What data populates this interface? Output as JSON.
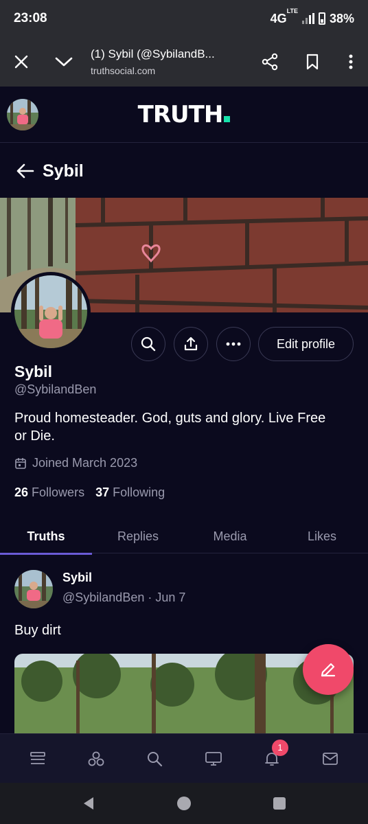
{
  "status_bar": {
    "time": "23:08",
    "network": "4G",
    "network_sub": "LTE",
    "battery": "38%"
  },
  "browser": {
    "page_title": "(1) Sybil (@SybilandB...",
    "domain": "truthsocial.com"
  },
  "header": {
    "logo": "TRUTH"
  },
  "profile_nav": {
    "name": "Sybil"
  },
  "profile": {
    "name": "Sybil",
    "handle": "@SybilandBen",
    "bio": "Proud homesteader. God, guts and glory. Live Free or Die.",
    "joined": "Joined March 2023",
    "followers_count": "26",
    "followers_label": "Followers",
    "following_count": "37",
    "following_label": "Following",
    "edit_label": "Edit profile"
  },
  "tabs": [
    {
      "label": "Truths",
      "active": true
    },
    {
      "label": "Replies",
      "active": false
    },
    {
      "label": "Media",
      "active": false
    },
    {
      "label": "Likes",
      "active": false
    }
  ],
  "post": {
    "author": "Sybil",
    "meta": "@SybilandBen · Jun 7",
    "text": "Buy dirt"
  },
  "bottom_nav": {
    "items": [
      "feed-icon",
      "groups-icon",
      "search-icon",
      "tv-icon",
      "bell-icon",
      "mail-icon"
    ],
    "notification_badge": "1"
  },
  "colors": {
    "background": "#0b0a1e",
    "accent": "#6b5bd6",
    "fab": "#f0496a",
    "logo_dot": "#17e2ab"
  }
}
